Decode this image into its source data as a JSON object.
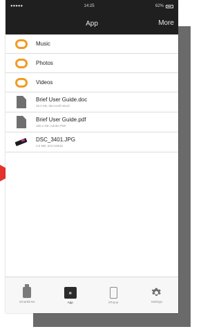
{
  "status_bar": {
    "carrier": "●●●●●",
    "time": "14:25",
    "battery": "62%"
  },
  "nav": {
    "title": "App",
    "more_label": "More"
  },
  "folders": [
    {
      "name": "Music"
    },
    {
      "name": "Photos"
    },
    {
      "name": "Videos"
    }
  ],
  "files": [
    {
      "name": "Brief User Guide.doc",
      "meta": "26.0 KB, Microsoft Word",
      "type": "doc"
    },
    {
      "name": "Brief User Guide.pdf",
      "meta": "180.2 KB, Adobe PDF",
      "type": "doc"
    },
    {
      "name": "DSC_3401.JPG",
      "meta": "3.6 MB, 5417x3616",
      "type": "jpg"
    }
  ],
  "tabs": [
    {
      "label": "SmartDrive",
      "icon": "drive-icon"
    },
    {
      "label": "App",
      "icon": "app-icon",
      "active": true
    },
    {
      "label": "iPhone",
      "icon": "phone-icon"
    },
    {
      "label": "Settings",
      "icon": "gear-icon"
    }
  ],
  "colors": {
    "accent": "#f39a22",
    "annotation_arrow": "#e5322d",
    "bar_dark": "#1f1f1f"
  }
}
